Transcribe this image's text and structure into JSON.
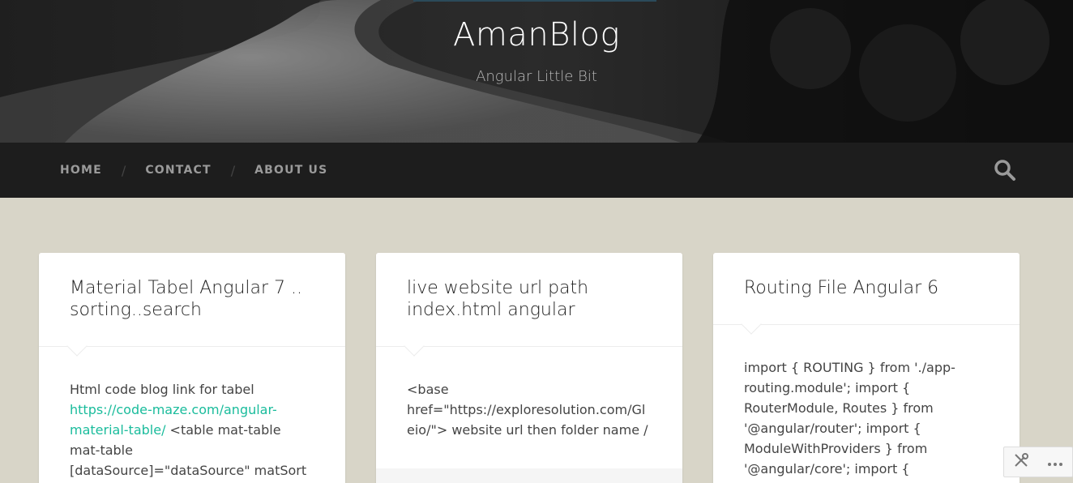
{
  "header": {
    "title": "AmanBlog",
    "description": "Angular Little Bit"
  },
  "nav": {
    "items": [
      {
        "label": "HOME"
      },
      {
        "label": "CONTACT"
      },
      {
        "label": "ABOUT US"
      }
    ],
    "separator": "/",
    "search_icon": "search-icon"
  },
  "posts": [
    {
      "title": "Material Tabel Angular 7 .. sorting..search",
      "excerpt_prefix": "Html code blog link for tabel ",
      "excerpt_link": "https://code-maze.com/angular-material-table/",
      "excerpt_suffix": " <table mat-table mat-table [dataSource]=\"dataSource\" matSort matSortStart=\"desc\"> <ng-"
    },
    {
      "title": "live website url path index.html angular",
      "excerpt": "<base href=\"https://exploresolution.com/Gleio/\"> website url then folder name /"
    },
    {
      "title": "Routing File Angular 6",
      "excerpt": "import { ROUTING } from './app-routing.module'; import { RouterModule, Routes } from '@angular/router'; import { ModuleWithProviders } from '@angular/core'; import {"
    }
  ],
  "widget": {
    "tools_icon": "tools-icon",
    "more_icon": "more-icon"
  },
  "colors": {
    "background": "#d8d5c8",
    "nav_bg": "#1d1d1d",
    "link": "#1abc9c"
  }
}
